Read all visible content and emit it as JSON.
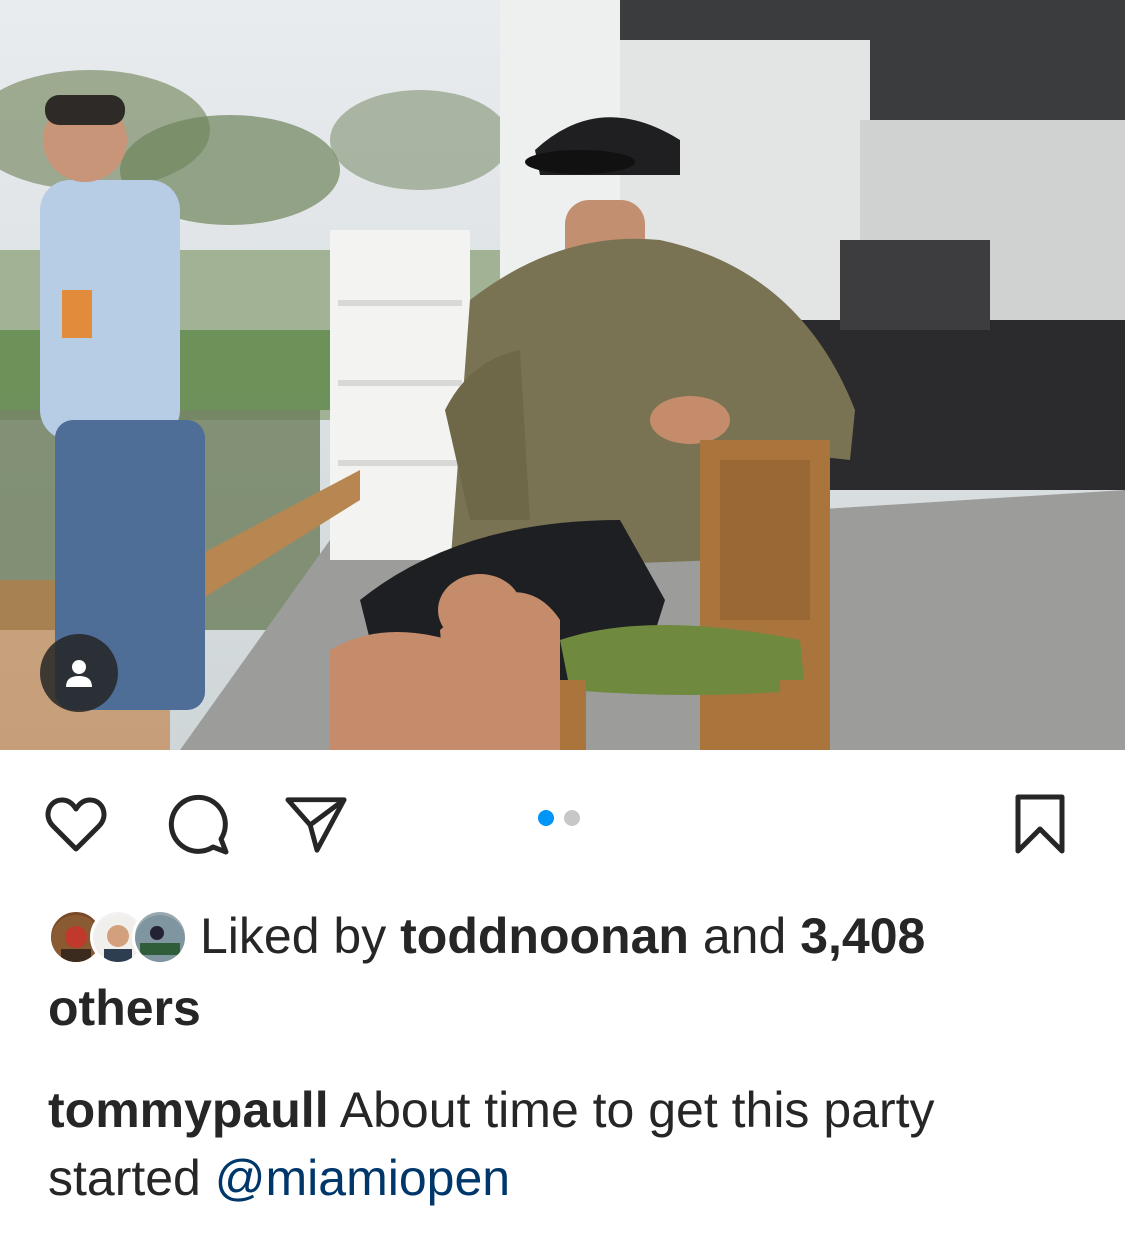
{
  "post": {
    "photo_alt": "Man in olive hoodie and black cap seated on wooden chair",
    "tag_icon": "person-icon",
    "carousel": {
      "total": 2,
      "current": 1
    },
    "action_icons": [
      "heart-icon",
      "comment-icon",
      "share-icon",
      "bookmark-icon"
    ],
    "likes": {
      "prefix": "Liked by",
      "user": "toddnoonan",
      "joiner": "and",
      "count": "3,408",
      "suffix": "others"
    },
    "caption": {
      "username": "tommypaull",
      "text": "About time to get this party started",
      "mention": "@miamiopen"
    }
  },
  "colors": {
    "accent": "#0095f6",
    "mention": "#00376b",
    "text": "#262626"
  }
}
